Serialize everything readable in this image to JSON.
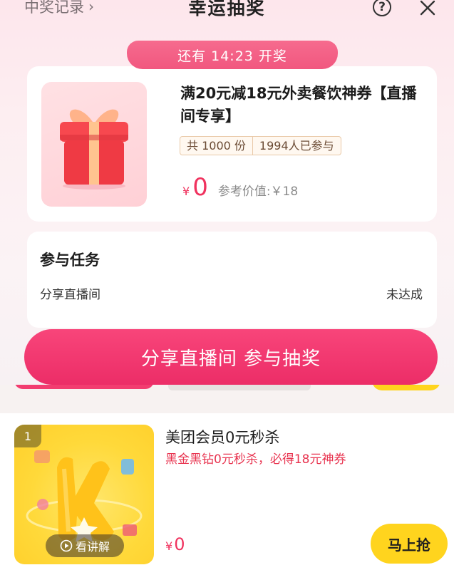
{
  "header": {
    "record_link": "中奖记录",
    "title": "幸运抽奖"
  },
  "lottery": {
    "countdown": "还有 14:23 开奖",
    "prize_title": "满20元减18元外卖餐饮神券【直播间专享】",
    "total": "共 1000 份",
    "participants": "1994人已参与",
    "currency": "¥",
    "price": "0",
    "reference_price": "参考价值:￥18"
  },
  "tasks": {
    "heading": "参与任务",
    "items": [
      {
        "name": "分享直播间",
        "status": "未达成"
      }
    ]
  },
  "cta": {
    "label": "分享直播间 参与抽奖"
  },
  "product": {
    "rank": "1",
    "watch_label": "看讲解",
    "title": "美团会员0元秒杀",
    "subtitle": "黑金黑钻0元秒杀，必得18元神券",
    "currency": "¥",
    "price": "0",
    "buy_label": "马上抢"
  },
  "colors": {
    "accent": "#f0325e",
    "cta": "#f23d70",
    "buy": "#ffd41e"
  }
}
